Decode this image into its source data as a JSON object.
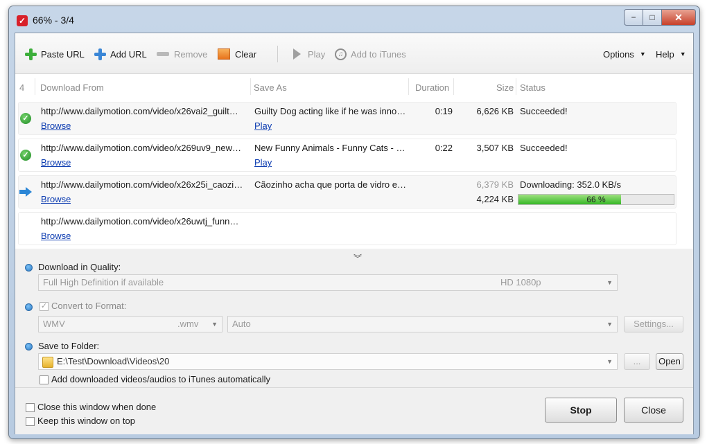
{
  "window": {
    "title": "66% - 3/4",
    "controls": {
      "minimize": "−",
      "maximize": "□",
      "close": "✕"
    }
  },
  "toolbar": {
    "paste_url": "Paste URL",
    "add_url": "Add URL",
    "remove": "Remove",
    "clear": "Clear",
    "play": "Play",
    "add_to_itunes": "Add to iTunes",
    "options": "Options",
    "help": "Help"
  },
  "list": {
    "count": "4",
    "columns": {
      "download_from": "Download From",
      "save_as": "Save As",
      "duration": "Duration",
      "size": "Size",
      "status": "Status"
    },
    "rows": [
      {
        "url": "http://www.dailymotion.com/video/x26vai2_guilt…",
        "browse": "Browse",
        "save_as": "Guilty Dog acting like if he was inno…",
        "play": "Play",
        "duration": "0:19",
        "size": "6,626 KB",
        "status": "Succeeded!"
      },
      {
        "url": "http://www.dailymotion.com/video/x269uv9_new…",
        "browse": "Browse",
        "save_as": "New Funny Animals - Funny Cats - …",
        "play": "Play",
        "duration": "0:22",
        "size": "3,507 KB",
        "status": "Succeeded!"
      },
      {
        "url": "http://www.dailymotion.com/video/x26x25i_caozi…",
        "browse": "Browse",
        "save_as": "Cãozinho acha que porta de vidro e…",
        "total_size": "6,379 KB",
        "size": "4,224 KB",
        "status": "Downloading: 352.0 KB/s",
        "progress_text": "66 %",
        "progress": 0.66
      },
      {
        "url": "http://www.dailymotion.com/video/x26uwtj_funn…",
        "browse": "Browse"
      }
    ]
  },
  "settings": {
    "quality_label": "Download in Quality:",
    "quality_value": "Full High Definition if available",
    "quality_res": "HD 1080p",
    "convert_label": "Convert to Format:",
    "format_value": "WMV",
    "format_ext": ".wmv",
    "format_auto": "Auto",
    "settings_button": "Settings...",
    "folder_label": "Save to Folder:",
    "folder_value": "E:\\Test\\Download\\Videos\\20",
    "browse_button": "...",
    "open_button": "Open",
    "itunes_auto": "Add downloaded videos/audios to iTunes automatically"
  },
  "footer": {
    "close_when_done": "Close this window when done",
    "keep_on_top": "Keep this window on top",
    "stop": "Stop",
    "close": "Close"
  },
  "colors": {
    "link": "#0a3ab0",
    "progress_fill": "#35b826",
    "success": "#1f8a26",
    "downloading_arrow": "#2b86d6"
  }
}
